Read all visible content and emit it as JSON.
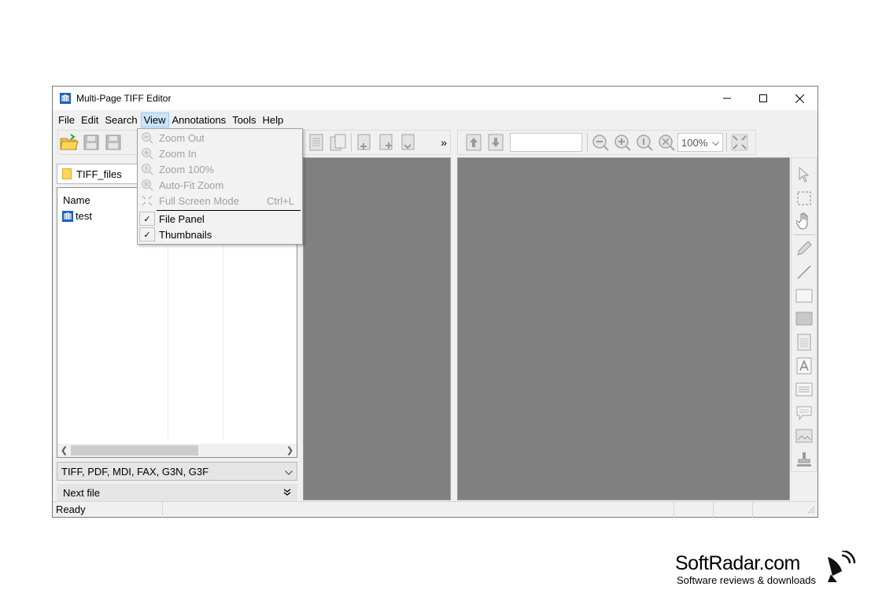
{
  "window": {
    "title": "Multi-Page TIFF Editor",
    "minimize": "—",
    "maximize": "☐",
    "close": "✕"
  },
  "menu": [
    "File",
    "Edit",
    "Search",
    "View",
    "Annotations",
    "Tools",
    "Help"
  ],
  "view_menu": {
    "items": [
      {
        "label": "Zoom Out",
        "icon": "zoom-out-icon",
        "disabled": true,
        "shortcut": ""
      },
      {
        "label": "Zoom In",
        "icon": "zoom-in-icon",
        "disabled": true,
        "shortcut": ""
      },
      {
        "label": "Zoom 100%",
        "icon": "zoom-100-icon",
        "disabled": true,
        "shortcut": ""
      },
      {
        "label": "Auto-Fit Zoom",
        "icon": "auto-fit-zoom-icon",
        "disabled": true,
        "shortcut": ""
      },
      {
        "label": "Full Screen Mode",
        "icon": "full-screen-icon",
        "disabled": true,
        "shortcut": "Ctrl+L"
      },
      {
        "label": "File Panel",
        "checked": true
      },
      {
        "label": "Thumbnails",
        "checked": true
      }
    ]
  },
  "toolbar": {
    "overflow": "»",
    "zoom_value": "100%",
    "page_input": ""
  },
  "file_panel": {
    "folder": "TIFF_files",
    "column_name": "Name",
    "files": [
      "test"
    ],
    "filter": "TIFF, PDF, MDI, FAX, G3N, G3F",
    "next_file": "Next file",
    "scroll_position": 0.6
  },
  "status": {
    "text": "Ready"
  },
  "brand": {
    "name": "SoftRadar.com",
    "tagline": "Software reviews & downloads"
  }
}
